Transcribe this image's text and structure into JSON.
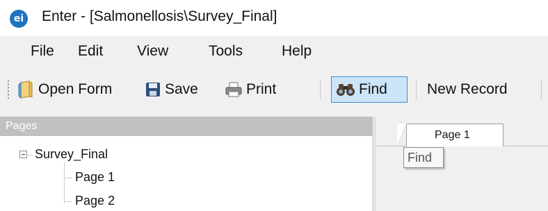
{
  "window": {
    "icon_label": "ei",
    "title": "Enter - [Salmonellosis\\Survey_Final]"
  },
  "menu": {
    "items": [
      "File",
      "Edit",
      "View",
      "Tools",
      "Help"
    ]
  },
  "toolbar": {
    "open_form_label": "Open Form",
    "save_label": "Save",
    "print_label": "Print",
    "find_label": "Find",
    "new_record_label": "New Record",
    "find_active": true
  },
  "pages_panel": {
    "header": "Pages",
    "root": "Survey_Final",
    "pages": [
      "Page 1",
      "Page 2"
    ],
    "selected": "Page 1"
  },
  "tabs": {
    "active_tab": "Page 1",
    "tooltip": "Find"
  },
  "colors": {
    "active_button_bg": "#cce4f7",
    "active_button_border": "#3d8ed6",
    "app_icon": "#1e73be",
    "pages_header_bg": "#c0c0c0"
  }
}
